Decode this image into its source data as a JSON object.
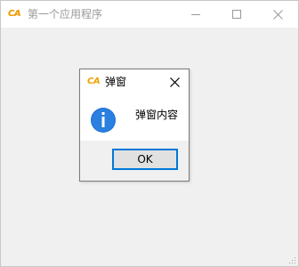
{
  "window": {
    "icon_text": "CA",
    "title": "第一个应用程序",
    "icons": {
      "minimize": "minimize-icon",
      "maximize": "maximize-icon",
      "close": "close-icon"
    }
  },
  "dialog": {
    "icon_text": "CA",
    "title": "弹窗",
    "message": "弹窗内容",
    "icon": "info-icon",
    "ok_label": "OK"
  },
  "colors": {
    "accent": "#0078d7",
    "window_bg": "#f0f0f0",
    "titlebar_bg": "#ffffff",
    "inactive_title": "#999999",
    "app_icon": "#f0a000"
  }
}
